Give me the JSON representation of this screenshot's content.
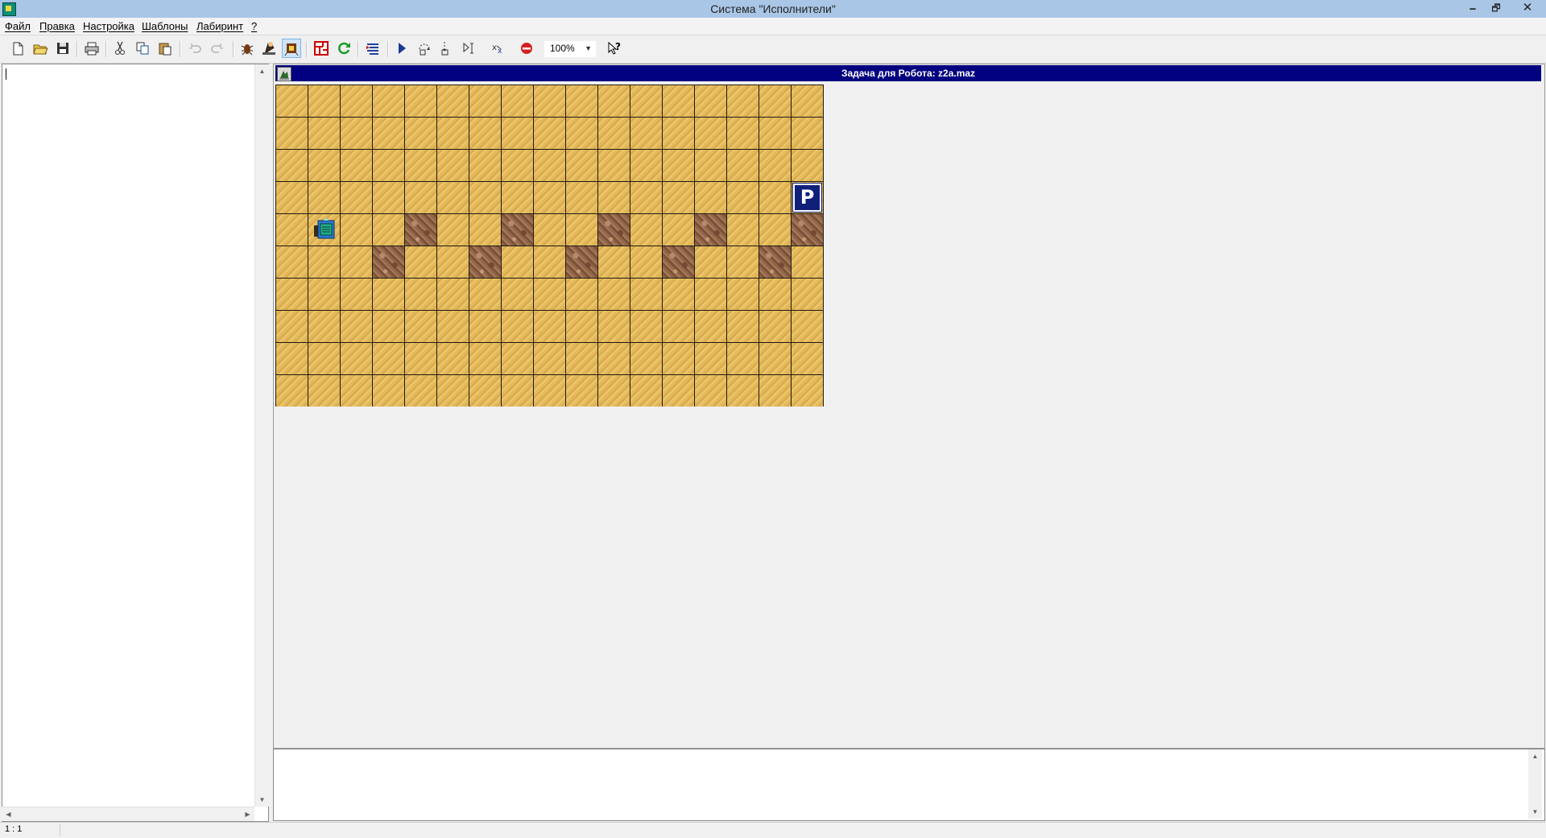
{
  "window": {
    "title": "Система \"Исполнители\"",
    "controls": {
      "minimize": "🗕",
      "maximize": "🗗",
      "close": "✕"
    }
  },
  "menu": [
    {
      "label": "Файл"
    },
    {
      "label": "Правка"
    },
    {
      "label": "Настройка"
    },
    {
      "label": "Шаблоны"
    },
    {
      "label": "Лабиринт"
    },
    {
      "label": "?"
    }
  ],
  "toolbar": {
    "zoom": "100%",
    "icons": [
      "new-file-icon",
      "open-folder-icon",
      "save-icon",
      "print-icon",
      "cut-icon",
      "copy-icon",
      "paste-icon",
      "undo-icon",
      "redo-icon",
      "bug-icon",
      "robot-executor-icon",
      "robot-task-icon",
      "maze-editor-icon",
      "refresh-icon",
      "align-icon",
      "run-icon",
      "step-over-icon",
      "step-into-icon",
      "run-to-cursor-icon",
      "variables-icon",
      "stop-icon",
      "zoom-dropdown",
      "help-pointer-icon"
    ]
  },
  "maze": {
    "title": "Задача для Робота: z2a.maz",
    "cols": 17,
    "rows": 10,
    "walls": [
      [
        4,
        4
      ],
      [
        4,
        7
      ],
      [
        4,
        10
      ],
      [
        4,
        13
      ],
      [
        4,
        16
      ],
      [
        5,
        3
      ],
      [
        5,
        6
      ],
      [
        5,
        9
      ],
      [
        5,
        12
      ],
      [
        5,
        15
      ]
    ],
    "robot": {
      "row": 4,
      "col": 1,
      "facing": "east"
    },
    "parking": {
      "row": 3,
      "col": 16,
      "label": "P"
    }
  },
  "statusbar": {
    "cursor": "1 : 1"
  },
  "colors": {
    "maze_header": "#000080",
    "sand": "#e3b85a",
    "wall": "#946749",
    "parking": "#0f1f7a"
  }
}
